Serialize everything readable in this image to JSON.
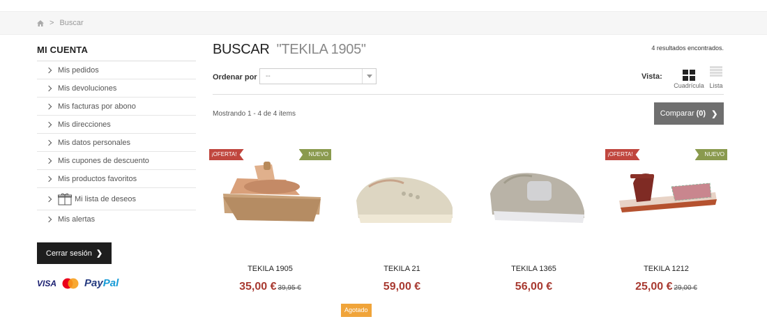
{
  "breadcrumb": {
    "home_icon": "home-icon",
    "separator": ">",
    "current": "Buscar"
  },
  "sidebar": {
    "title": "MI CUENTA",
    "items": [
      {
        "label": "Mis pedidos"
      },
      {
        "label": "Mis devoluciones"
      },
      {
        "label": "Mis facturas por abono"
      },
      {
        "label": "Mis direcciones"
      },
      {
        "label": "Mis datos personales"
      },
      {
        "label": "Mis cupones de descuento"
      },
      {
        "label": "Mis productos favoritos"
      },
      {
        "label": "Mi lista de deseos",
        "icon": "gift-icon"
      },
      {
        "label": "Mis alertas"
      }
    ],
    "logout_label": "Cerrar sesión",
    "payments": {
      "visa": "VISA",
      "paypal_1": "Pay",
      "paypal_2": "Pal"
    }
  },
  "search": {
    "title": "BUSCAR",
    "query": "\"TEKILA 1905\"",
    "results_text": "4 resultados encontrados.",
    "sort_label": "Ordenar por",
    "sort_value": "--",
    "view_label": "Vista:",
    "view_grid_label": "Cuadrícula",
    "view_list_label": "Lista",
    "showing_text": "Mostrando 1 - 4 de 4 items",
    "compare_label": "Comparar",
    "compare_count": "(0)"
  },
  "products": [
    {
      "name": "TEKILA 1905",
      "price": "35,00 €",
      "old_price": "39,95 €",
      "badge_left": "¡OFERTA!",
      "badge_right": "NUEVO"
    },
    {
      "name": "TEKILA 21",
      "price": "59,00 €",
      "status": "Agotado"
    },
    {
      "name": "TEKILA 1365",
      "price": "56,00 €"
    },
    {
      "name": "TEKILA 1212",
      "price": "25,00 €",
      "old_price": "29,00 €",
      "badge_left": "¡OFERTA!",
      "badge_right": "NUEVO"
    }
  ],
  "colors": {
    "price": "#a83a31",
    "oferta": "#c0463e",
    "nuevo": "#8a9a4e",
    "soldout": "#f0a43a",
    "compare_bg": "#6f6f6f",
    "logout_bg": "#1e1e1e"
  }
}
